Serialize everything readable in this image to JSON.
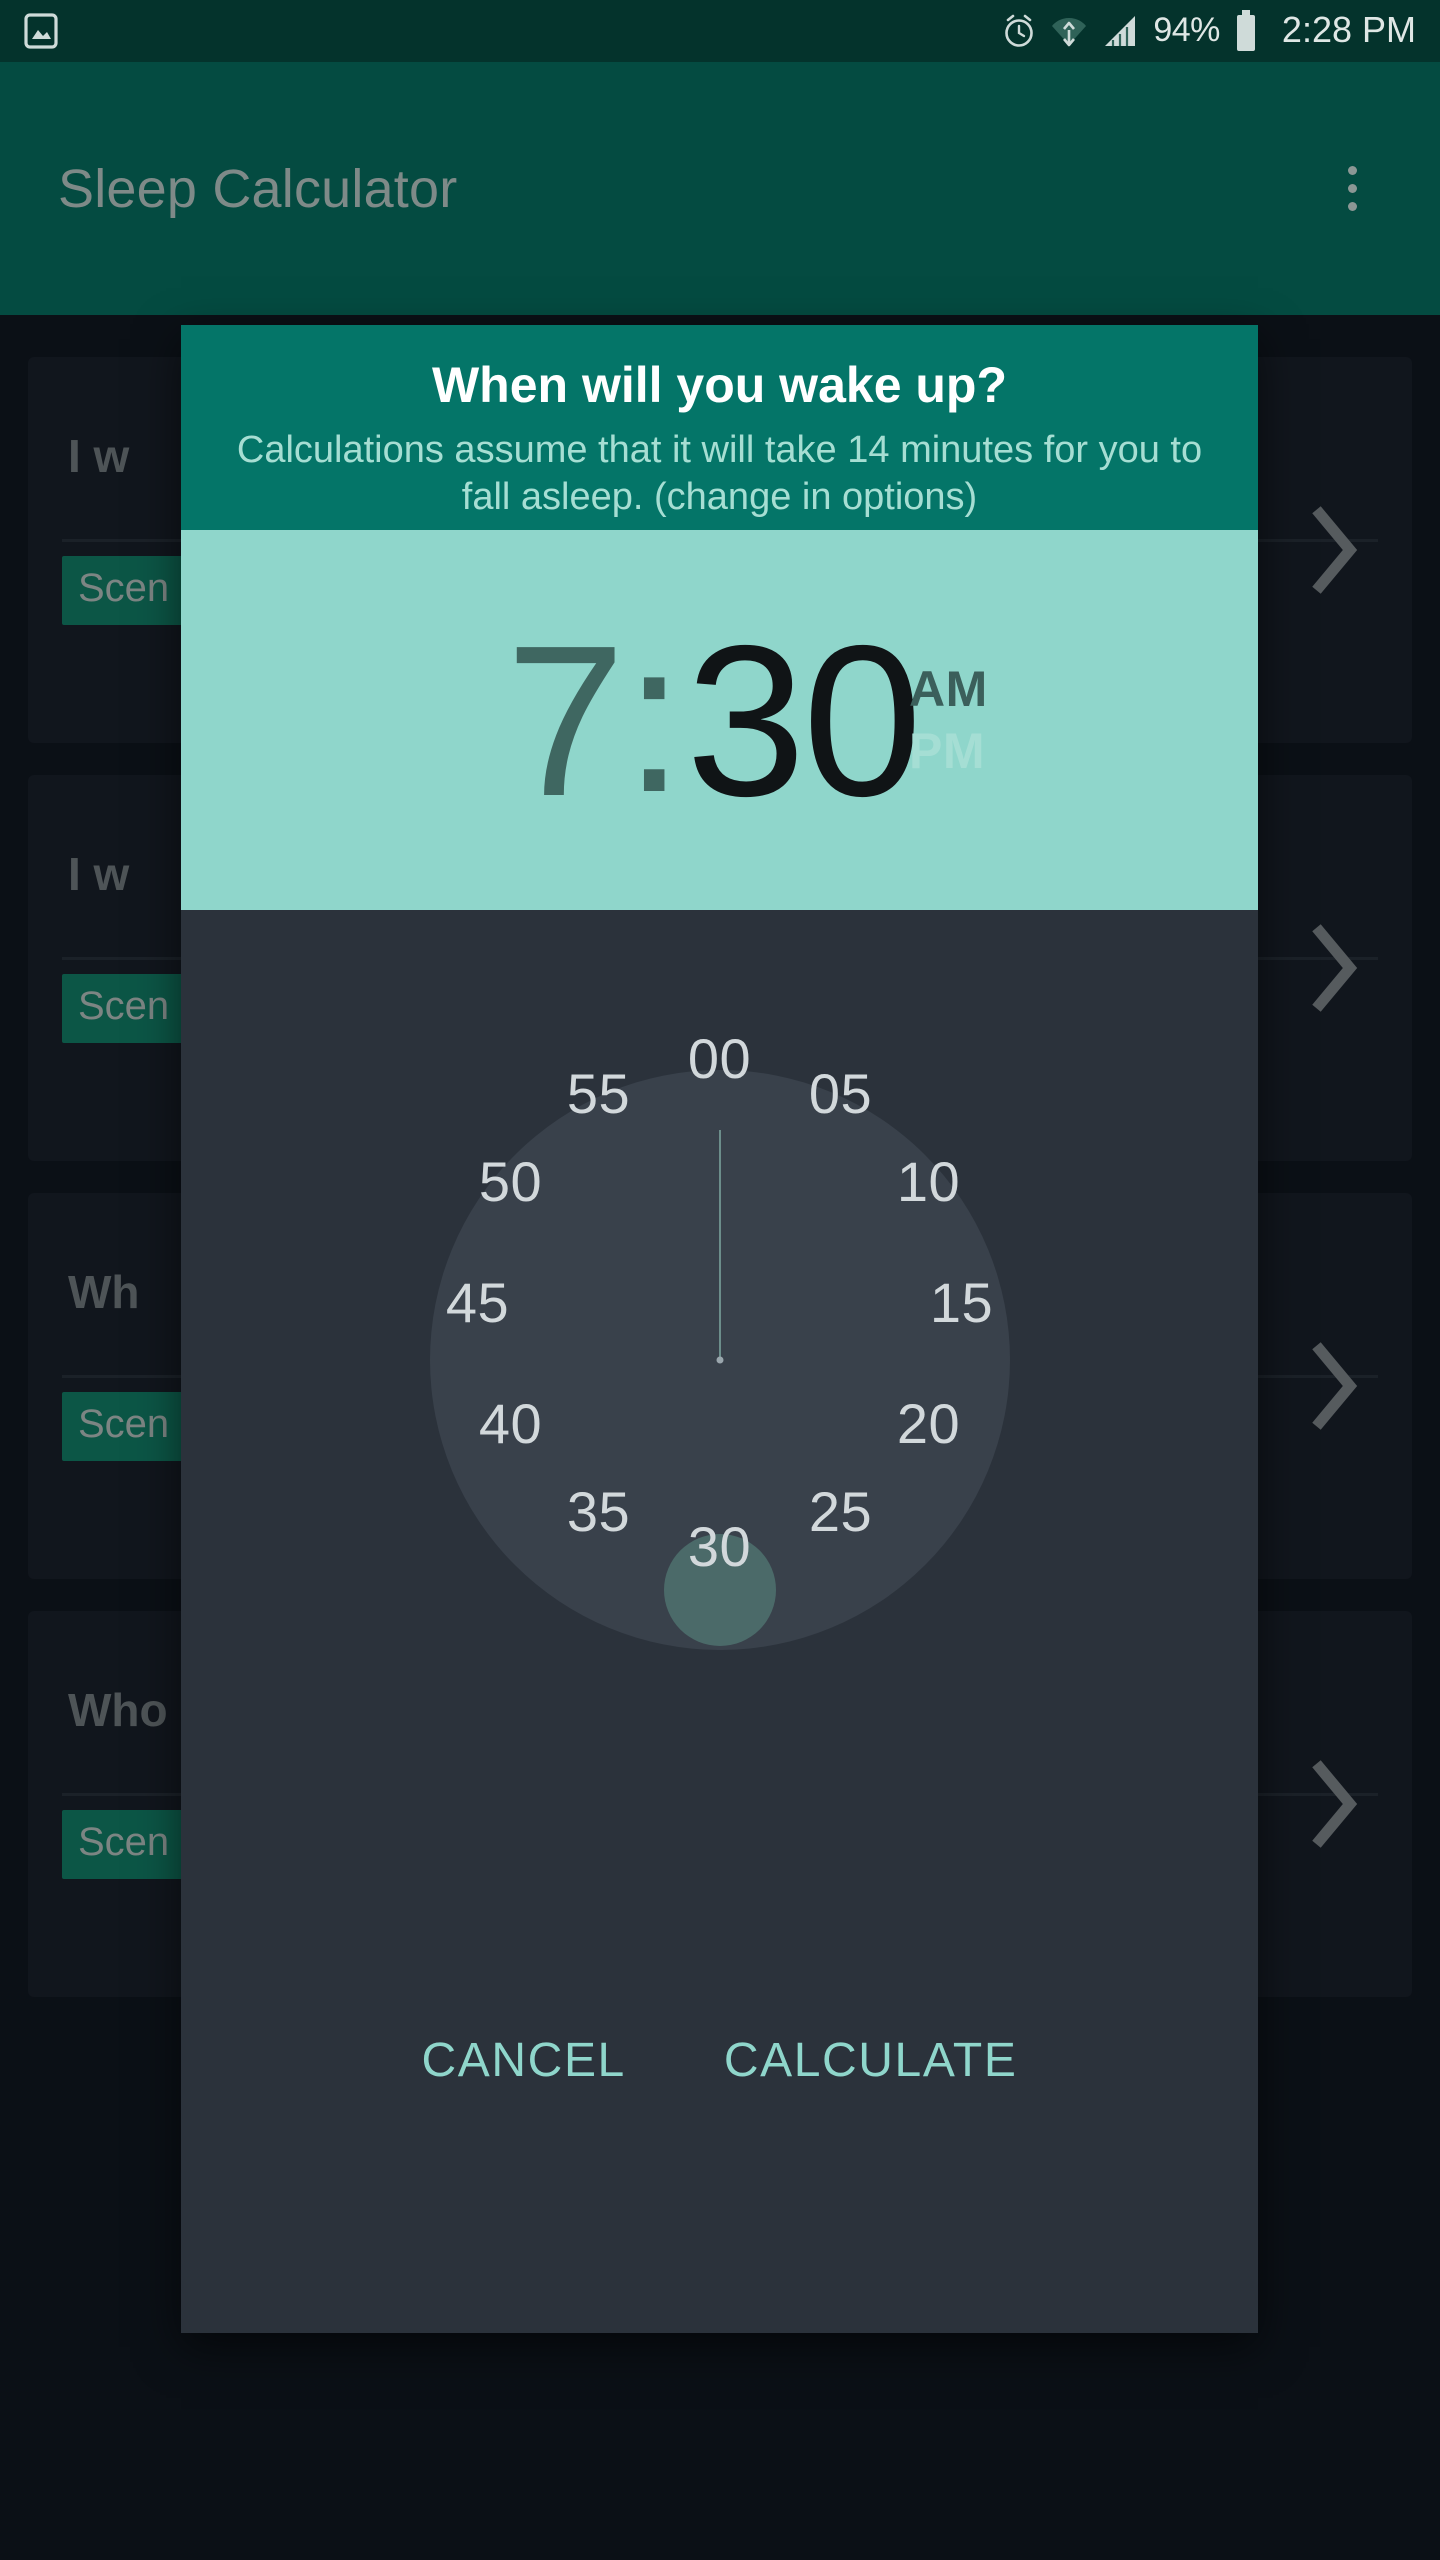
{
  "status_bar": {
    "left_icon": "image-icon",
    "icons": [
      "alarm-icon",
      "wifi-icon",
      "signal-icon"
    ],
    "battery_percent": "94%",
    "battery_icon": "battery-icon",
    "clock": "2:28 PM",
    "background_color": "#04332c",
    "text_color": "#dfe7e5"
  },
  "app_bar": {
    "title": "Sleep Calculator",
    "overflow_icon": "more-vertical-icon",
    "background_color": "#044b41",
    "title_color": "#7e8a88"
  },
  "background": {
    "cards": [
      {
        "title": "I w",
        "chip": "Scen",
        "chevron": "chevron-right-icon"
      },
      {
        "title": "I w",
        "chip": "Scen",
        "chevron": "chevron-right-icon"
      },
      {
        "title": "Wh",
        "chip": "Scen",
        "chevron": "chevron-right-icon"
      },
      {
        "title": "Who",
        "chip": "Scen",
        "chevron": "chevron-right-icon"
      }
    ],
    "chip_color": "#0c5646",
    "card_color": "#11161d"
  },
  "dialog": {
    "title": "When will you wake up?",
    "subtitle": "Calculations assume that it will take 14 minutes for you to fall asleep. (change in options)",
    "header_color": "#047568",
    "accent_color": "#8fd6cb",
    "surface_color": "#2b323b",
    "time": {
      "hour": "7",
      "separator": ":",
      "minute": "30",
      "am_label": "AM",
      "pm_label": "PM",
      "selected_meridiem": "AM",
      "active_field": "minute",
      "strip_background": "#8fd6cb",
      "active_text_color": "#101416",
      "inactive_text_color": "#3f6761"
    },
    "clock": {
      "mode": "minutes",
      "selected_value": "30",
      "ticks": [
        "00",
        "05",
        "10",
        "15",
        "20",
        "25",
        "30",
        "35",
        "40",
        "45",
        "50",
        "55"
      ],
      "face_color": "#39414b",
      "selection_color": "#4b6a69",
      "tick_text_color": "#d2d8db"
    },
    "actions": {
      "cancel_label": "CANCEL",
      "confirm_label": "CALCULATE",
      "text_color": "#8fd6cb"
    }
  }
}
